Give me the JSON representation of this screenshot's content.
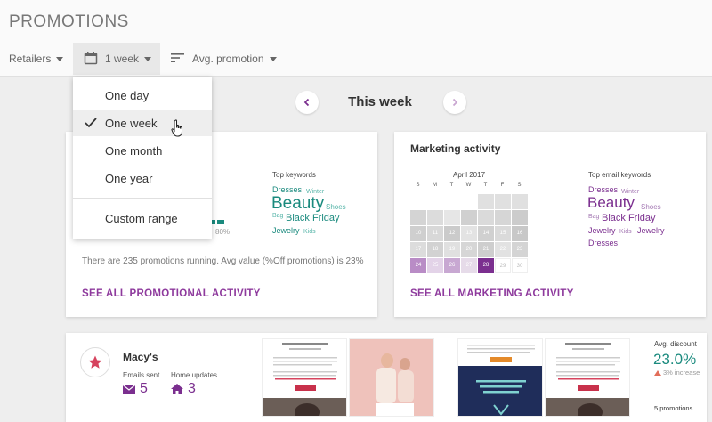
{
  "app": {
    "title": "PROMOTIONS"
  },
  "toolbar": {
    "retailers_label": "Retailers",
    "week_label": "1 week",
    "avg_label": "Avg. promotion"
  },
  "dropdown": {
    "items": [
      {
        "label": "One day",
        "selected": false
      },
      {
        "label": "One week",
        "selected": true
      },
      {
        "label": "One month",
        "selected": false
      },
      {
        "label": "One year",
        "selected": false
      }
    ],
    "custom_label": "Custom range"
  },
  "week_nav": {
    "label": "This week"
  },
  "promo_card": {
    "keywords_heading": "Top keywords",
    "keywords": [
      "Dresses",
      "Winter",
      "Beauty",
      "Shoes",
      "Bag",
      "Black Friday",
      "Jewelry",
      "Kids"
    ],
    "percent_label": "80%",
    "note": "There are 235 promotions running. Avg value (%Off promotions) is 23%",
    "link": "SEE ALL PROMOTIONAL ACTIVITY"
  },
  "marketing_card": {
    "title": "Marketing activity",
    "calendar_title": "April 2017",
    "days_of_week": [
      "S",
      "M",
      "T",
      "W",
      "T",
      "F",
      "S"
    ],
    "calendar_numbers": [
      "10",
      "11",
      "12",
      "13",
      "14",
      "15",
      "16",
      "17",
      "18",
      "19",
      "20",
      "21",
      "22",
      "23",
      "24",
      "25",
      "26",
      "27",
      "28",
      "29",
      "30"
    ],
    "keywords_heading": "Top email keywords",
    "keywords": [
      "Dresses",
      "Winter",
      "Beauty",
      "Shoes",
      "Bag",
      "Black Friday",
      "Jewelry",
      "Kids",
      "Jewelry",
      "Dresses"
    ],
    "link": "SEE ALL MARKETING ACTIVITY"
  },
  "retailer_row": {
    "name": "Macy's",
    "emails_label": "Emails sent",
    "emails_value": "5",
    "home_label": "Home updates",
    "home_value": "3",
    "avg_label": "Avg. discount",
    "avg_value": "23.0%",
    "increase": "3% increase",
    "promotions_count": "5 promotions"
  },
  "colors": {
    "accent_purple": "#7b2f8f",
    "accent_teal": "#1a8a7e"
  }
}
